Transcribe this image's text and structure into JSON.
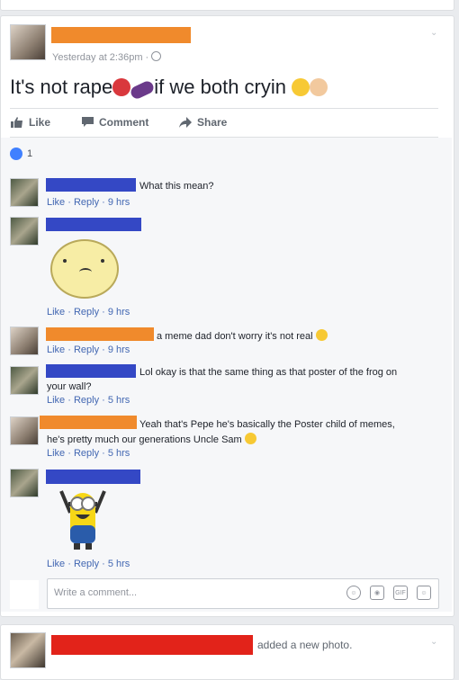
{
  "post": {
    "timestamp": "Yesterday at 2:36pm ·",
    "text_a": "It's not rape",
    "text_b": "if we both cryin",
    "actions": {
      "like": "Like",
      "comment": "Comment",
      "share": "Share"
    },
    "reaction_count": "1"
  },
  "comments": [
    {
      "text": "What this mean?",
      "meta": "Like · Reply · 9 hrs"
    },
    {
      "text": "",
      "meta": "Like · Reply · 9 hrs"
    },
    {
      "text": "a meme dad don't worry it's not real",
      "meta": "Like · Reply · 9 hrs"
    },
    {
      "text": "Lol okay is that the same thing as that poster of the frog on",
      "text2": "your wall?",
      "meta": "Like · Reply · 5 hrs"
    },
    {
      "text": "Yeah that's Pepe he's basically the Poster child of memes,",
      "text2": "he's pretty much our generations Uncle Sam",
      "meta": "Like · Reply · 5 hrs"
    },
    {
      "text": "",
      "meta": "Like · Reply · 5 hrs"
    }
  ],
  "composer": {
    "placeholder": "Write a comment..."
  },
  "next_post": {
    "text": "added a new photo."
  },
  "colors": {
    "redact_orange": "#f08a2c",
    "redact_blue": "#3448c5",
    "redact_red": "#e2231a",
    "link": "#4267b2"
  }
}
